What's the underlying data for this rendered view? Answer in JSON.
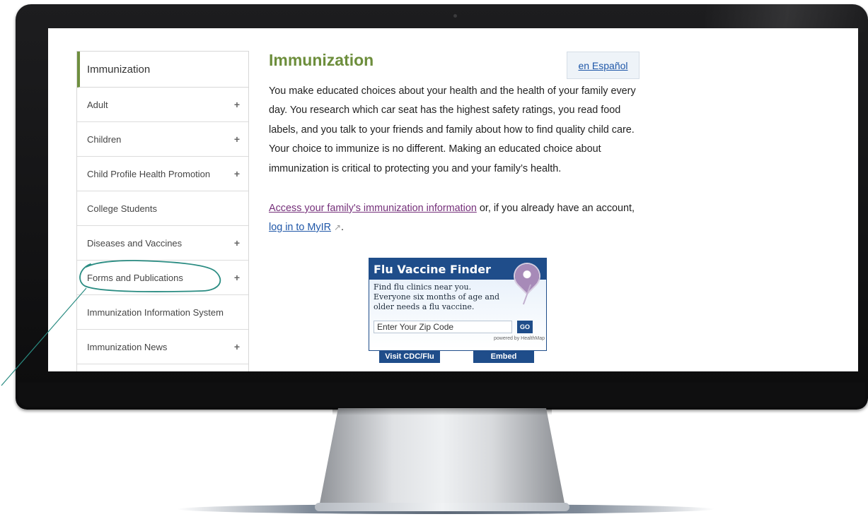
{
  "sidebar": {
    "heading": "Immunization",
    "items": [
      {
        "label": "Adult",
        "expand": "+"
      },
      {
        "label": "Children",
        "expand": "+"
      },
      {
        "label": "Child Profile Health Promotion",
        "expand": "+"
      },
      {
        "label": "College Students",
        "expand": ""
      },
      {
        "label": "Diseases and Vaccines",
        "expand": "+"
      },
      {
        "label": "Forms and Publications",
        "expand": "+"
      },
      {
        "label": "Immunization Information System",
        "expand": ""
      },
      {
        "label": "Immunization News",
        "expand": "+"
      }
    ]
  },
  "main": {
    "title": "Immunization",
    "language_link": "en Español",
    "intro": "You make educated choices about your health and the health of your family every day. You research which car seat has the highest safety ratings, you read food labels, and you talk to your friends and family about how to find quality child care. Your choice to immunize is no different. Making an educated choice about immunization is critical to protecting you and your family’s health.",
    "access_link": "Access your family's immunization information",
    "access_middle": " or, if you already have an account, ",
    "login_link": "log in to MyIR",
    "external_icon": "external-link-icon",
    "access_end": "."
  },
  "flu_widget": {
    "title": "Flu Vaccine Finder",
    "line1": "Find flu clinics near you.",
    "line2": "Everyone six months of age and",
    "line3": "older needs a flu vaccine.",
    "zip_value": "Enter Your Zip Code",
    "go_label": "GO",
    "powered_by": "powered by HealthMap",
    "visit_label": "Visit CDC/Flu",
    "embed_label": "Embed",
    "pin_icon": "map-pin-icon"
  },
  "colors": {
    "title_green": "#6d8e3c",
    "sidebar_accent": "#6f8f3f",
    "link_blue": "#1f57a8",
    "link_visited": "#75307a",
    "widget_blue": "#1f4d8a",
    "annotation_teal": "#2a8c82"
  }
}
